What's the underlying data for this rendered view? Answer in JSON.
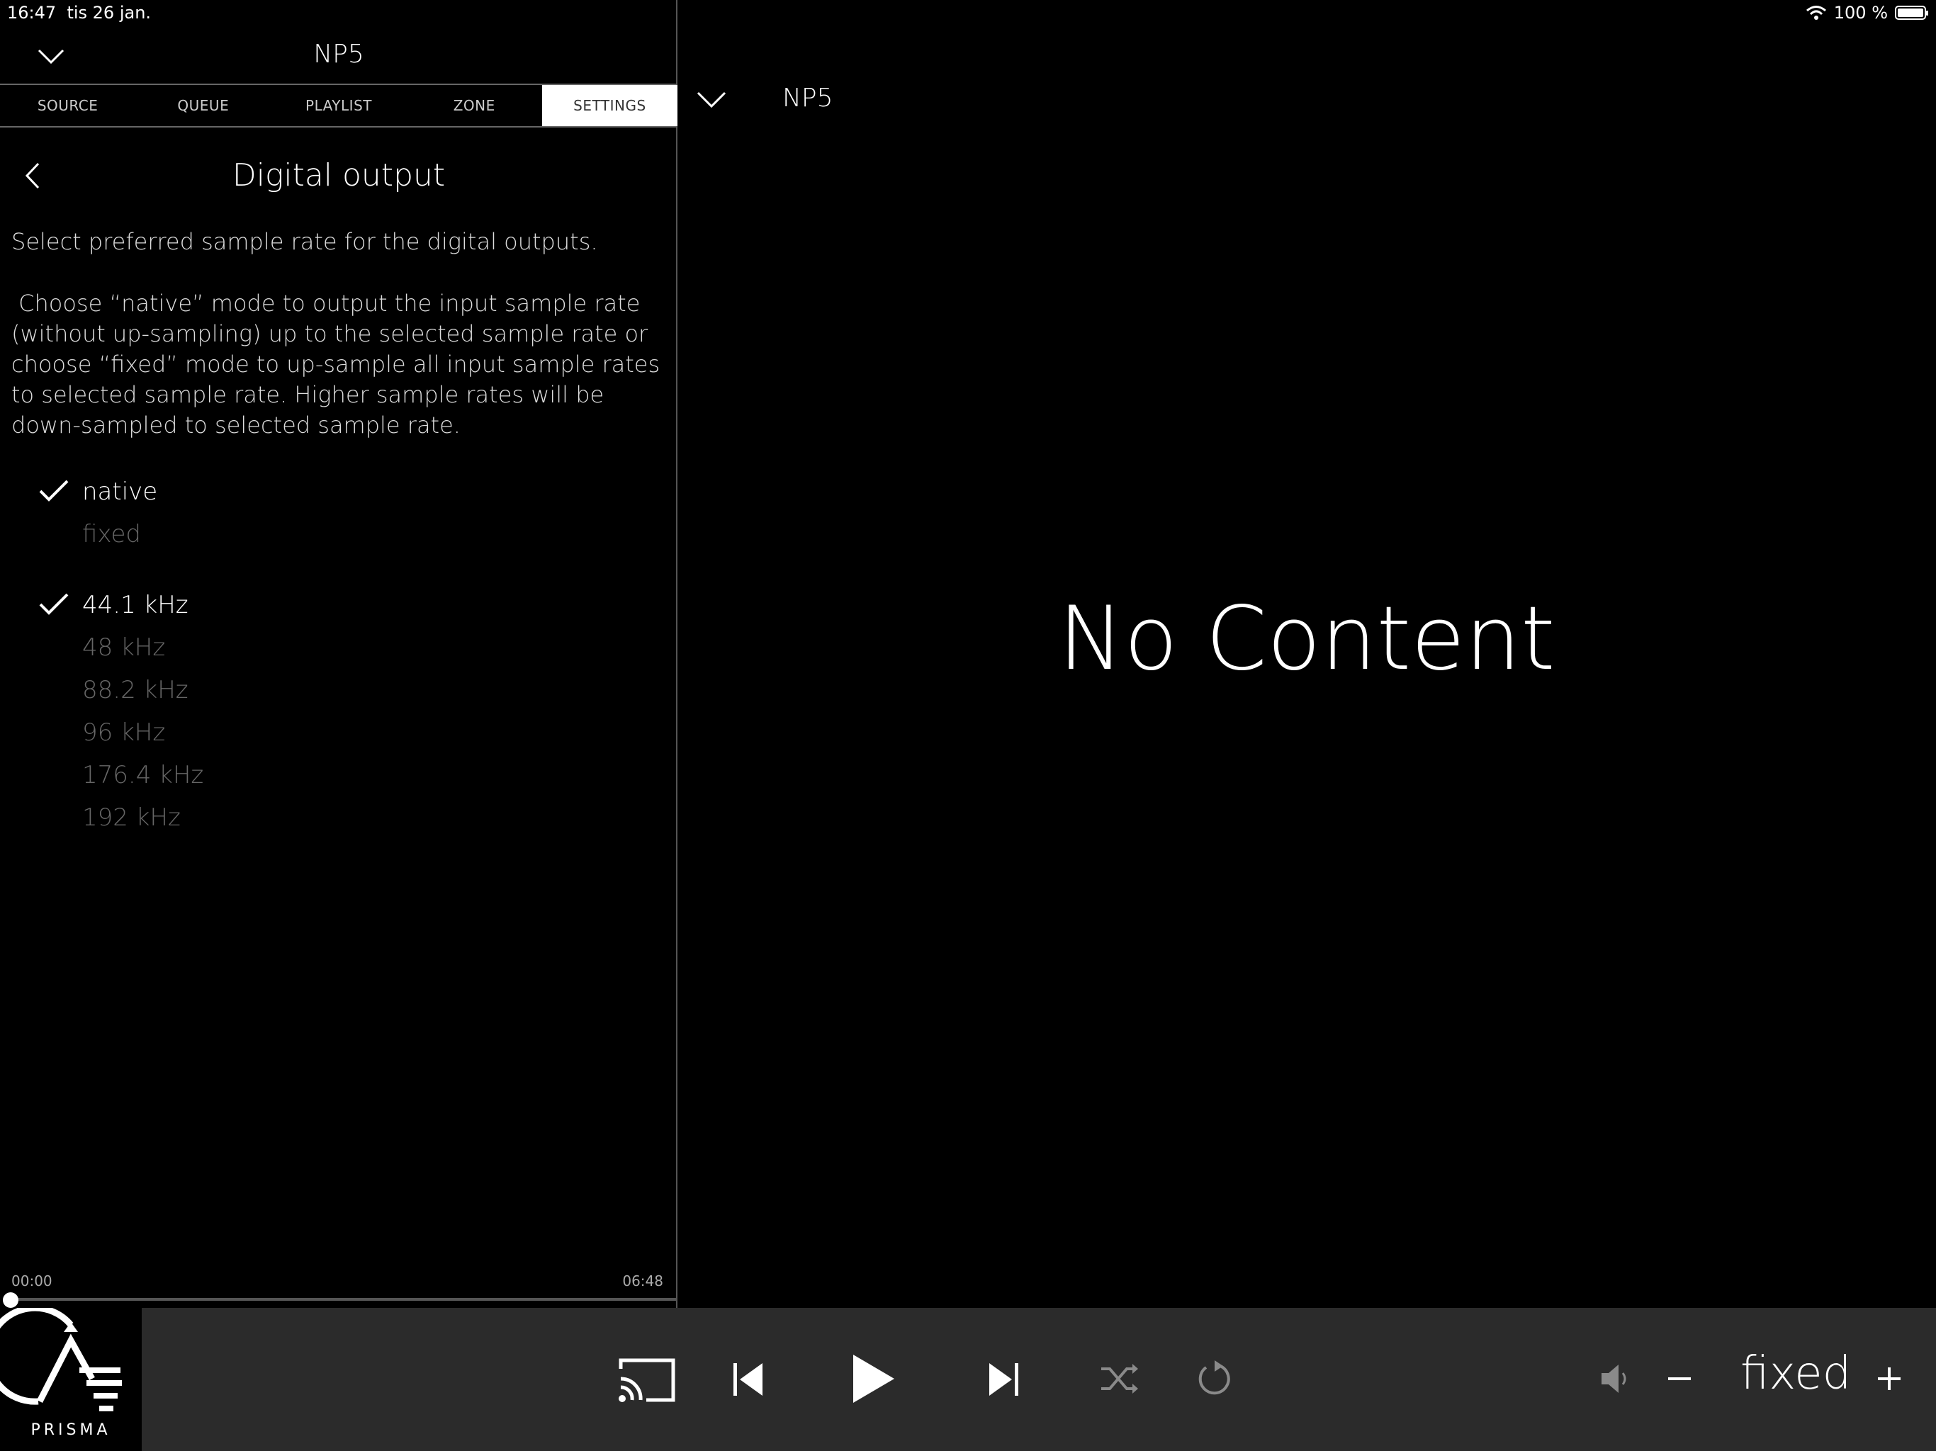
{
  "status_bar": {
    "time": "16:47",
    "date": "tis 26 jan.",
    "battery": "100 %"
  },
  "left_panel": {
    "title": "NP5",
    "tabs": [
      {
        "label": "SOURCE",
        "active": false
      },
      {
        "label": "QUEUE",
        "active": false
      },
      {
        "label": "PLAYLIST",
        "active": false
      },
      {
        "label": "ZONE",
        "active": false
      },
      {
        "label": "SETTINGS",
        "active": true
      }
    ],
    "page_title": "Digital output",
    "description_1": "Select preferred sample rate for the digital outputs.",
    "description_2": " Choose “native” mode to output the input sample rate (without up-sampling) up to the selected sample rate or choose “fixed” mode to up-sample all input sample rates to selected sample rate. Higher sample rates will be down-sampled to selected sample rate.",
    "modes": [
      {
        "label": "native",
        "selected": true
      },
      {
        "label": "fixed",
        "selected": false
      }
    ],
    "sample_rates": [
      {
        "label": "44.1 kHz",
        "selected": true
      },
      {
        "label": "48 kHz",
        "selected": false
      },
      {
        "label": "88.2 kHz",
        "selected": false
      },
      {
        "label": "96 kHz",
        "selected": false
      },
      {
        "label": "176.4 kHz",
        "selected": false
      },
      {
        "label": "192 kHz",
        "selected": false
      }
    ],
    "time_elapsed": "00:00",
    "time_total": "06:48"
  },
  "right_panel": {
    "title": "NP5",
    "empty_message": "No Content"
  },
  "player": {
    "logo_text": "PRISMA",
    "volume_mode": "fixed",
    "icons": [
      "cast-icon",
      "previous-icon",
      "play-icon",
      "next-icon",
      "shuffle-icon",
      "repeat-icon",
      "volume-icon",
      "minus-icon",
      "plus-icon"
    ]
  },
  "colors": {
    "background": "#000000",
    "player_bar": "#2b2b2b",
    "active_tab_bg": "#ffffff",
    "unselected_option": "#666666",
    "disabled_control": "#8a8a8a"
  }
}
